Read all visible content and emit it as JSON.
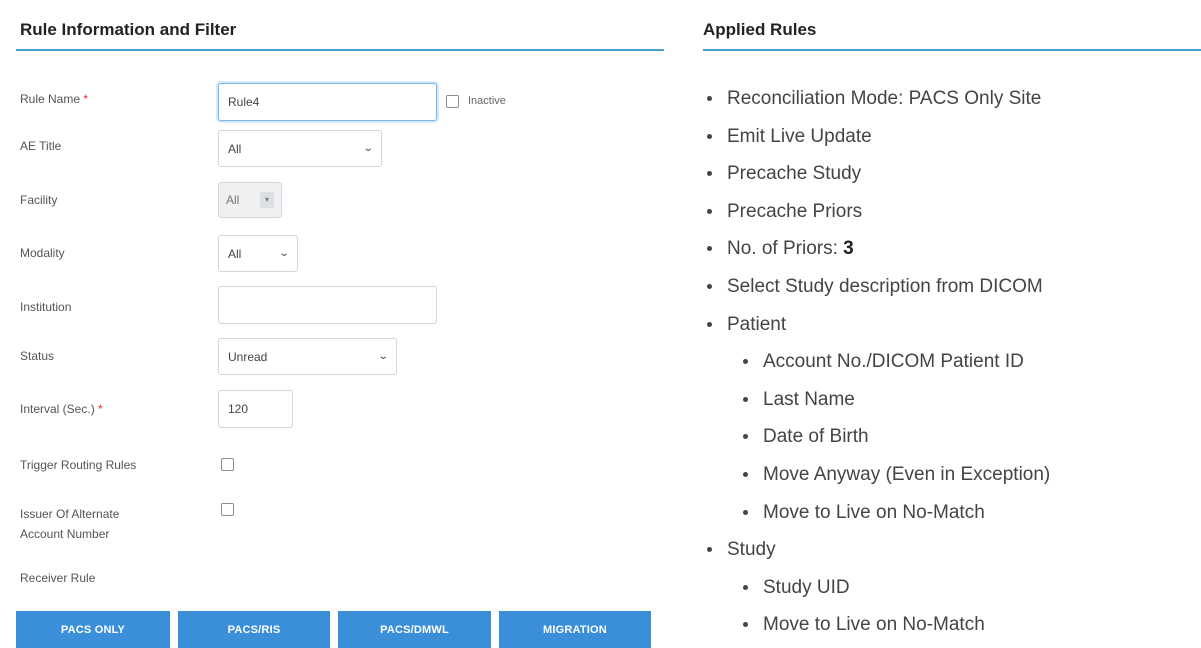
{
  "left": {
    "title": "Rule Information and Filter",
    "fields": {
      "rule_name": {
        "label": "Rule Name",
        "required": "*",
        "value": "Rule4"
      },
      "inactive_label": "Inactive",
      "ae_title": {
        "label": "AE Title",
        "value": "All"
      },
      "facility": {
        "label": "Facility",
        "value": "All"
      },
      "modality": {
        "label": "Modality",
        "value": "All"
      },
      "institution": {
        "label": "Institution",
        "value": ""
      },
      "status": {
        "label": "Status",
        "value": "Unread"
      },
      "interval": {
        "label": "Interval (Sec.)",
        "required": "*",
        "value": "120"
      },
      "trigger_routing": {
        "label": "Trigger Routing Rules"
      },
      "issuer_line1": "Issuer Of Alternate",
      "issuer_line2": "Account Number",
      "receiver_rule": {
        "label": "Receiver Rule"
      }
    },
    "buttons": [
      "PACS ONLY",
      "PACS/RIS",
      "PACS/DMWL",
      "MIGRATION"
    ]
  },
  "right": {
    "title": "Applied Rules",
    "rules": {
      "reconciliation": "Reconciliation Mode: PACS Only Site",
      "emit_live": "Emit Live Update",
      "precache_study": "Precache Study",
      "precache_priors": "Precache Priors",
      "priors_label": "No. of Priors: ",
      "priors_value": "3",
      "select_study_desc": "Select Study description from DICOM",
      "patient": "Patient",
      "patient_items": [
        "Account No./DICOM Patient ID",
        "Last Name",
        "Date of Birth",
        "Move Anyway (Even in Exception)",
        "Move to Live on No-Match"
      ],
      "study": "Study",
      "study_items": [
        "Study UID",
        "Move to Live on No-Match"
      ]
    }
  },
  "colors": {
    "accent": "#3a8fd8",
    "required": "#e03131",
    "rule_line": "#4a9fd8"
  }
}
